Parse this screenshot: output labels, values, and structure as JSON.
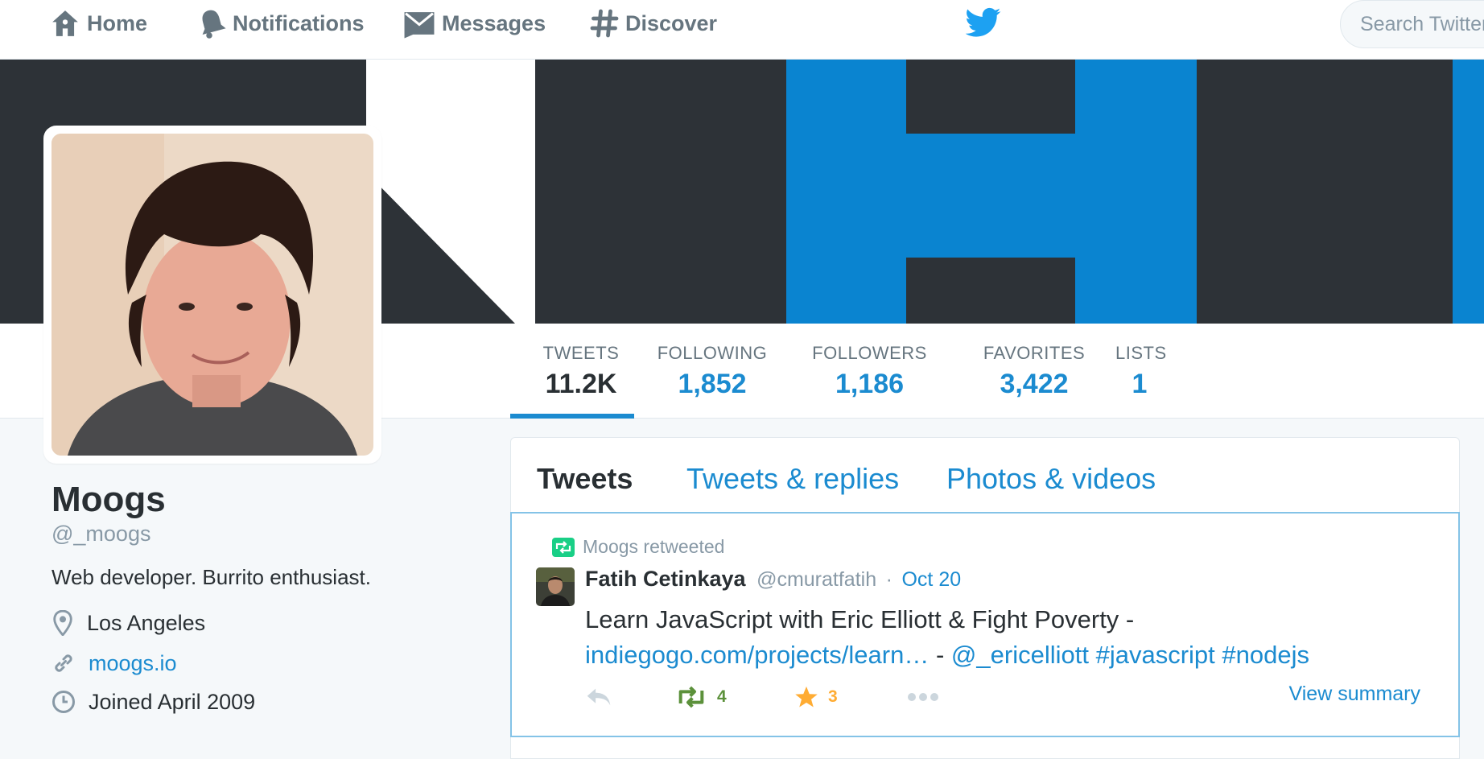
{
  "nav": {
    "home": "Home",
    "notifications": "Notifications",
    "messages": "Messages",
    "discover": "Discover",
    "search_placeholder": "Search Twitter"
  },
  "profile_nav": {
    "stats": [
      {
        "label": "TWEETS",
        "value": "11.2K"
      },
      {
        "label": "FOLLOWING",
        "value": "1,852"
      },
      {
        "label": "FOLLOWERS",
        "value": "1,186"
      },
      {
        "label": "FAVORITES",
        "value": "3,422"
      },
      {
        "label": "LISTS",
        "value": "1"
      }
    ]
  },
  "profile": {
    "name": "Moogs",
    "handle": "@_moogs",
    "bio": "Web developer. Burrito enthusiast.",
    "location": "Los Angeles",
    "url": "moogs.io",
    "joined": "Joined April 2009"
  },
  "timeline": {
    "tabs": [
      "Tweets",
      "Tweets & replies",
      "Photos & videos"
    ],
    "tweet": {
      "retweeted_by": "Moogs retweeted",
      "fullname": "Fatih Cetinkaya",
      "screen_name": "@cmuratfatih",
      "separator": "·",
      "time": "Oct 20",
      "text": "Learn JavaScript with Eric Elliott & Fight Poverty -",
      "link": "indiegogo.com/projects/learn…",
      "dash": "-",
      "mention": "@_ericelliott",
      "hashtag1": "#javascript",
      "hashtag2": "#nodejs",
      "retweet_count": "4",
      "favorite_count": "3",
      "view_summary": "View summary"
    }
  },
  "colors": {
    "link_blue": "#1b8bd0",
    "retweet_green": "#5c913b",
    "favorite_gold": "#ffac33",
    "banner_dark": "#2d3237",
    "banner_blue": "#0a84d0"
  }
}
